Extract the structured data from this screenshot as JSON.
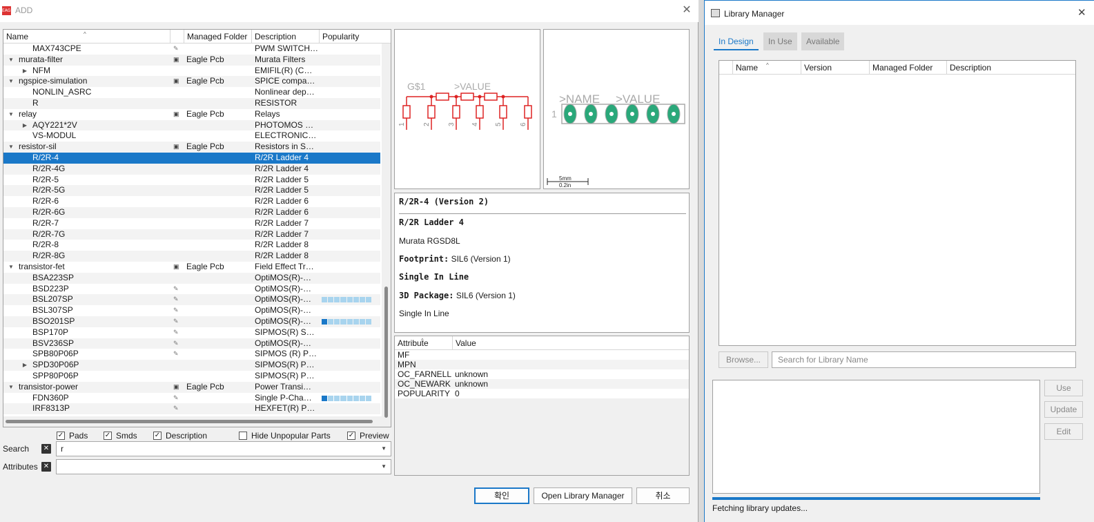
{
  "add_dialog": {
    "title": "ADD",
    "app_icon_text": "EAGLE",
    "columns": [
      "Name",
      "Managed Folder",
      "Description",
      "Popularity"
    ],
    "rows": [
      {
        "name": "MAX743CPE",
        "indent": 2,
        "exp": "",
        "icon": "pen",
        "folder": "",
        "desc": "PWM SWITCH…",
        "pop": null
      },
      {
        "name": "murata-filter",
        "indent": 1,
        "exp": "▼",
        "icon": "lib",
        "folder": "Eagle Pcb",
        "desc": "Murata Filters",
        "pop": null
      },
      {
        "name": "NFM",
        "indent": 2,
        "exp": "▶",
        "icon": "",
        "folder": "",
        "desc": "EMIFIL(R) (C…",
        "pop": null
      },
      {
        "name": "ngspice-simulation",
        "indent": 1,
        "exp": "▼",
        "icon": "lib",
        "folder": "Eagle Pcb",
        "desc": "SPICE compa…",
        "pop": null
      },
      {
        "name": "NONLIN_ASRC",
        "indent": 2,
        "exp": "",
        "icon": "",
        "folder": "",
        "desc": "Nonlinear dep…",
        "pop": null
      },
      {
        "name": "R",
        "indent": 2,
        "exp": "",
        "icon": "",
        "folder": "",
        "desc": "RESISTOR",
        "pop": null
      },
      {
        "name": "relay",
        "indent": 1,
        "exp": "▼",
        "icon": "lib",
        "folder": "Eagle Pcb",
        "desc": "Relays",
        "pop": null
      },
      {
        "name": "AQY221*2V",
        "indent": 2,
        "exp": "▶",
        "icon": "",
        "folder": "",
        "desc": "PHOTOMOS …",
        "pop": null
      },
      {
        "name": "VS-MODUL",
        "indent": 2,
        "exp": "",
        "icon": "",
        "folder": "",
        "desc": "ELECTRONIC…",
        "pop": null
      },
      {
        "name": "resistor-sil",
        "indent": 1,
        "exp": "▼",
        "icon": "lib",
        "folder": "Eagle Pcb",
        "desc": "Resistors in S…",
        "pop": null
      },
      {
        "name": "R/2R-4",
        "indent": 2,
        "exp": "",
        "icon": "",
        "folder": "",
        "desc": "R/2R Ladder 4",
        "pop": null,
        "selected": true
      },
      {
        "name": "R/2R-4G",
        "indent": 2,
        "exp": "",
        "icon": "",
        "folder": "",
        "desc": "R/2R Ladder 4",
        "pop": null
      },
      {
        "name": "R/2R-5",
        "indent": 2,
        "exp": "",
        "icon": "",
        "folder": "",
        "desc": "R/2R Ladder 5",
        "pop": null
      },
      {
        "name": "R/2R-5G",
        "indent": 2,
        "exp": "",
        "icon": "",
        "folder": "",
        "desc": "R/2R Ladder 5",
        "pop": null
      },
      {
        "name": "R/2R-6",
        "indent": 2,
        "exp": "",
        "icon": "",
        "folder": "",
        "desc": "R/2R Ladder 6",
        "pop": null
      },
      {
        "name": "R/2R-6G",
        "indent": 2,
        "exp": "",
        "icon": "",
        "folder": "",
        "desc": "R/2R Ladder 6",
        "pop": null
      },
      {
        "name": "R/2R-7",
        "indent": 2,
        "exp": "",
        "icon": "",
        "folder": "",
        "desc": "R/2R Ladder 7",
        "pop": null
      },
      {
        "name": "R/2R-7G",
        "indent": 2,
        "exp": "",
        "icon": "",
        "folder": "",
        "desc": "R/2R Ladder 7",
        "pop": null
      },
      {
        "name": "R/2R-8",
        "indent": 2,
        "exp": "",
        "icon": "",
        "folder": "",
        "desc": "R/2R Ladder 8",
        "pop": null
      },
      {
        "name": "R/2R-8G",
        "indent": 2,
        "exp": "",
        "icon": "",
        "folder": "",
        "desc": "R/2R Ladder 8",
        "pop": null
      },
      {
        "name": "transistor-fet",
        "indent": 1,
        "exp": "▼",
        "icon": "lib",
        "folder": "Eagle Pcb",
        "desc": "Field Effect Tr…",
        "pop": null
      },
      {
        "name": "BSA223SP",
        "indent": 2,
        "exp": "",
        "icon": "",
        "folder": "",
        "desc": "OptiMOS(R)-…",
        "pop": null
      },
      {
        "name": "BSD223P",
        "indent": 2,
        "exp": "",
        "icon": "pen",
        "folder": "",
        "desc": "OptiMOS(R)-…",
        "pop": null
      },
      {
        "name": "BSL207SP",
        "indent": 2,
        "exp": "",
        "icon": "pen",
        "folder": "",
        "desc": "OptiMOS(R)-…",
        "pop": 0
      },
      {
        "name": "BSL307SP",
        "indent": 2,
        "exp": "",
        "icon": "pen",
        "folder": "",
        "desc": "OptiMOS(R)-…",
        "pop": null
      },
      {
        "name": "BSO201SP",
        "indent": 2,
        "exp": "",
        "icon": "pen",
        "folder": "",
        "desc": "OptiMOS(R)-…",
        "pop": 1
      },
      {
        "name": "BSP170P",
        "indent": 2,
        "exp": "",
        "icon": "pen",
        "folder": "",
        "desc": "SIPMOS(R) S…",
        "pop": null
      },
      {
        "name": "BSV236SP",
        "indent": 2,
        "exp": "",
        "icon": "pen",
        "folder": "",
        "desc": "OptiMOS(R)-…",
        "pop": null
      },
      {
        "name": "SPB80P06P",
        "indent": 2,
        "exp": "",
        "icon": "pen",
        "folder": "",
        "desc": "SIPMOS (R) P…",
        "pop": null
      },
      {
        "name": "SPD30P06P",
        "indent": 2,
        "exp": "▶",
        "icon": "",
        "folder": "",
        "desc": "SIPMOS(R) P…",
        "pop": null
      },
      {
        "name": "SPP80P06P",
        "indent": 2,
        "exp": "",
        "icon": "",
        "folder": "",
        "desc": "SIPMOS(R) P…",
        "pop": null
      },
      {
        "name": "transistor-power",
        "indent": 1,
        "exp": "▼",
        "icon": "lib",
        "folder": "Eagle Pcb",
        "desc": "Power Transi…",
        "pop": null
      },
      {
        "name": "FDN360P",
        "indent": 2,
        "exp": "",
        "icon": "pen",
        "folder": "",
        "desc": "Single P-Cha…",
        "pop": 1
      },
      {
        "name": "IRF8313P",
        "indent": 2,
        "exp": "",
        "icon": "pen",
        "folder": "",
        "desc": "HEXFET(R) P…",
        "pop": null
      }
    ],
    "options": {
      "pads": "Pads",
      "smds": "Smds",
      "description": "Description",
      "hide_unpopular": "Hide Unpopular Parts",
      "preview": "Preview"
    },
    "search_label": "Search",
    "search_value": "r",
    "attributes_label": "Attributes",
    "attributes_value": "",
    "schematic": {
      "g": "G$1",
      "value": ">VALUE",
      "pins": [
        "1",
        "2",
        "3",
        "4",
        "5",
        "6"
      ]
    },
    "package": {
      "name": ">NAME",
      "value": ">VALUE",
      "pin1": "1",
      "scale_mm": "5mm",
      "scale_in": "0.2in"
    },
    "info": {
      "title": "R/2R-4 (Version 2)",
      "name": "R/2R Ladder 4",
      "desc": "Murata RGSD8L",
      "footprint_label": "Footprint:",
      "footprint_value": "SIL6 (Version 1)",
      "footprint_desc": "Single In Line",
      "pkg3d_label": "3D Package:",
      "pkg3d_value": "SIL6 (Version 1)",
      "pkg3d_desc": "Single In Line"
    },
    "attr_columns": [
      "Attribute",
      "Value"
    ],
    "attributes": [
      {
        "k": "MF",
        "v": ""
      },
      {
        "k": "MPN",
        "v": ""
      },
      {
        "k": "OC_FARNELL",
        "v": "unknown"
      },
      {
        "k": "OC_NEWARK",
        "v": "unknown"
      },
      {
        "k": "POPULARITY",
        "v": "0"
      }
    ],
    "ok_label": "확인",
    "open_lib_label": "Open Library Manager",
    "cancel_label": "취소"
  },
  "library_manager": {
    "title": "Library Manager",
    "tabs": [
      "In Design",
      "In Use",
      "Available"
    ],
    "columns": [
      "Name",
      "Version",
      "Managed Folder",
      "Description"
    ],
    "browse_label": "Browse...",
    "search_placeholder": "Search for Library Name",
    "use_label": "Use",
    "update_label": "Update",
    "edit_label": "Edit",
    "status": "Fetching library updates..."
  },
  "colors": {
    "accent": "#1a78c8",
    "schematic": "#d22",
    "pad": "#2aa87a"
  }
}
